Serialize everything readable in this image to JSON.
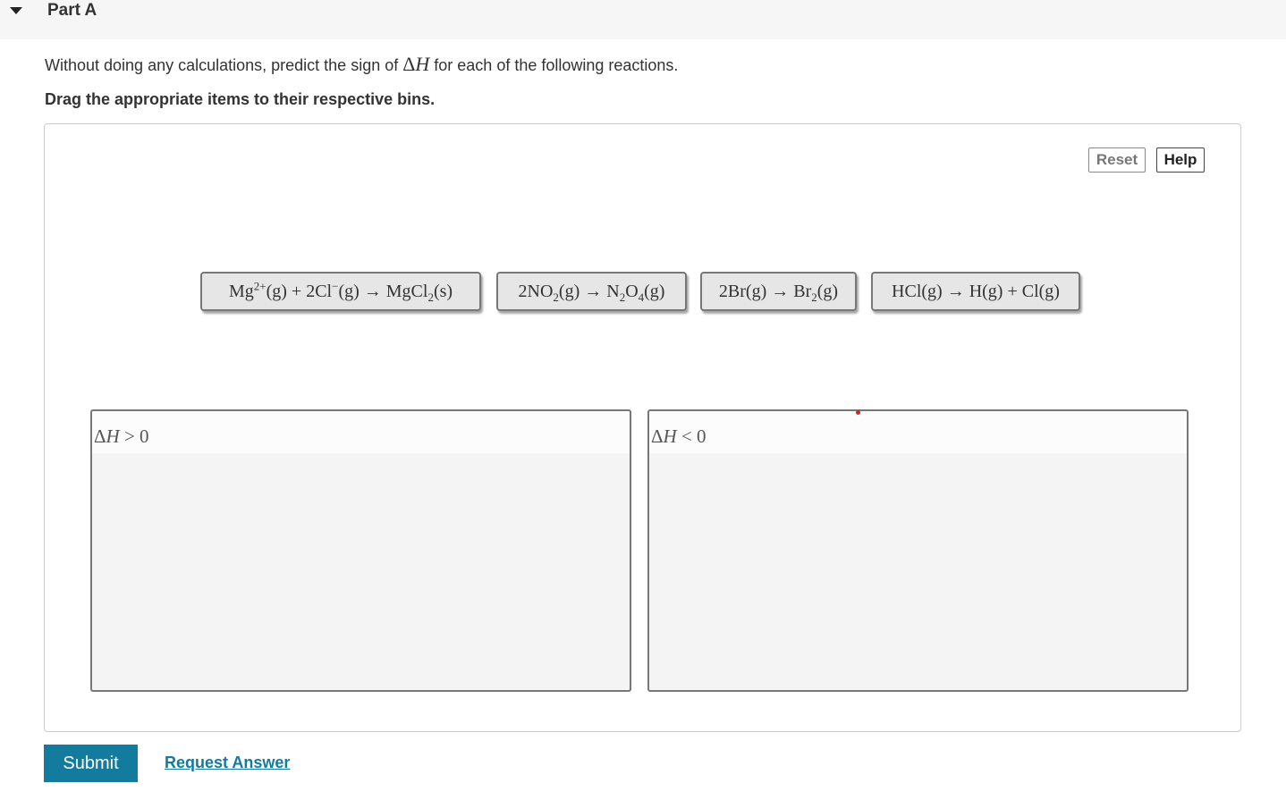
{
  "part": {
    "title": "Part A"
  },
  "question": {
    "before": "Without doing any calculations, predict the sign of ",
    "delta": "Δ",
    "variable": "H",
    "after": " for each of the following reactions."
  },
  "instruction": "Drag the appropriate items to their respective bins.",
  "toolbar": {
    "reset_label": "Reset",
    "help_label": "Help"
  },
  "items": [
    {
      "reactant_a": "Mg",
      "reactant_a_sup": "2+",
      "rest_a": "(g) + 2Cl",
      "rest_a_sup": "−",
      "rest_b": "(g) → MgCl",
      "rest_b_sub": "2",
      "rest_c": "(s)"
    },
    {
      "p1": "2NO",
      "p1_sub": "2",
      "p2": "(g) → N",
      "p2_sub": "2",
      "p3": "O",
      "p3_sub": "4",
      "p4": "(g)"
    },
    {
      "p1": "2Br(g) → Br",
      "p1_sub": "2",
      "p2": "(g)"
    },
    {
      "text": "HCl(g) → H(g) + Cl(g)"
    }
  ],
  "bins": [
    {
      "delta": "Δ",
      "variable": "H",
      "relation": " > 0"
    },
    {
      "delta": "Δ",
      "variable": "H",
      "relation": " < 0"
    }
  ],
  "actions": {
    "submit_label": "Submit",
    "request_answer_label": "Request Answer"
  },
  "colors": {
    "accent": "#137b9e",
    "marker": "#e02020"
  }
}
